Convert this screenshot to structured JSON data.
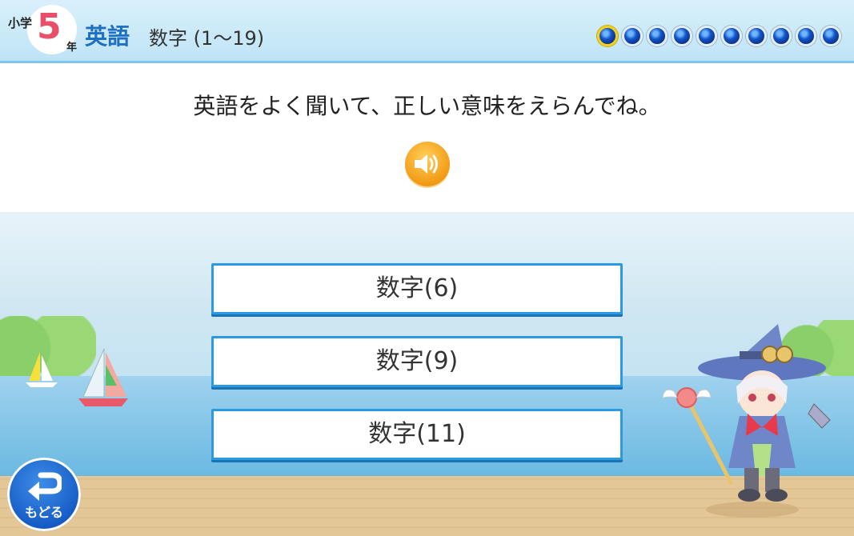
{
  "header": {
    "school_label": "小学",
    "grade": "5",
    "nen_label": "年",
    "subject": "英語",
    "unit_title": "数字 (1〜19)",
    "progress": {
      "total": 10,
      "current": 1
    }
  },
  "question": {
    "instruction": "英語をよく聞いて、正しい意味をえらんでね。",
    "sound_icon": "speaker-icon"
  },
  "answers": [
    {
      "label": "数字(6)"
    },
    {
      "label": "数字(9)"
    },
    {
      "label": "数字(11)"
    }
  ],
  "back_button": {
    "label": "もどる",
    "icon": "return-arrow-icon"
  },
  "colors": {
    "accent": "#2b9ae0",
    "subject": "#1f6fc2",
    "grade": "#e8506a",
    "sound": "#f29a14",
    "back": "#1257c2"
  }
}
